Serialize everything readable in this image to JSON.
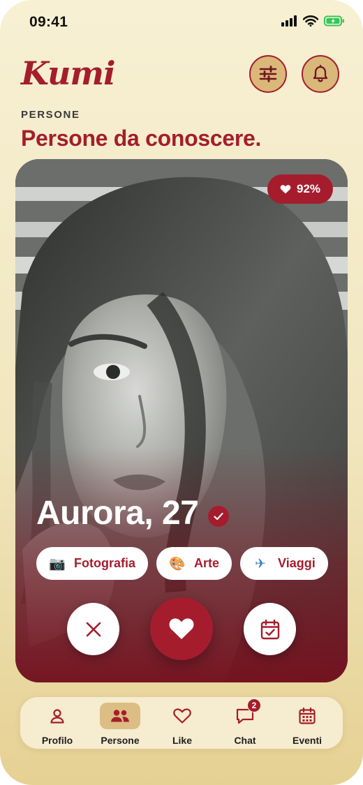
{
  "status_bar": {
    "time": "09:41"
  },
  "app": {
    "logo": "Kumi"
  },
  "header": {
    "filters_icon": "sliders-icon",
    "notifications_icon": "bell-icon"
  },
  "section": {
    "label": "PERSONE",
    "title": "Persone da conoscere."
  },
  "profile": {
    "match_label": "92%",
    "match_percent": 92,
    "name_age": "Aurora, 27",
    "verified": true,
    "interests": [
      {
        "emoji": "📷",
        "label": "Fotografia"
      },
      {
        "emoji": "🎨",
        "label": "Arte"
      },
      {
        "emoji": "✈",
        "label": "Viaggi"
      }
    ]
  },
  "actions": {
    "pass_icon": "close-icon",
    "like_icon": "heart-icon",
    "event_icon": "calendar-check-icon"
  },
  "nav": {
    "items": [
      {
        "label": "Profilo",
        "icon": "user-icon",
        "active": false
      },
      {
        "label": "Persone",
        "icon": "users-icon",
        "active": true
      },
      {
        "label": "Like",
        "icon": "heart-outline-icon",
        "active": false
      },
      {
        "label": "Chat",
        "icon": "chat-icon",
        "active": false,
        "badge": "2"
      },
      {
        "label": "Eventi",
        "icon": "calendar-icon",
        "active": false
      }
    ]
  },
  "colors": {
    "accent": "#a51d2d",
    "background": "#f3e9c4",
    "nav_active": "#dcbd83"
  }
}
